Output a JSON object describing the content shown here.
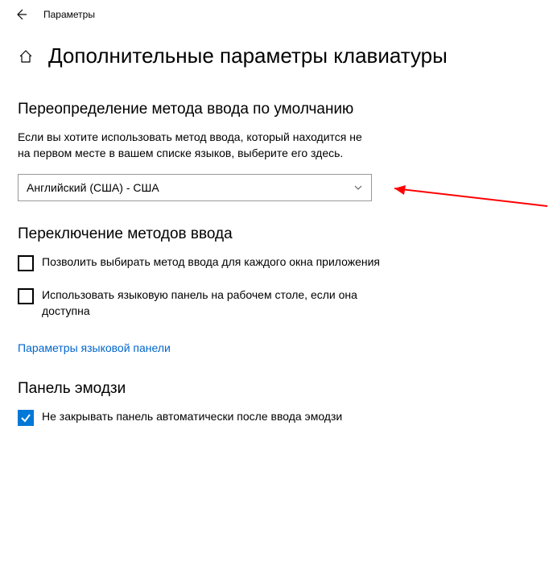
{
  "titlebar": {
    "title": "Параметры"
  },
  "header": {
    "title": "Дополнительные параметры клавиатуры"
  },
  "sections": {
    "override": {
      "title": "Переопределение метода ввода по умолчанию",
      "description": "Если вы хотите использовать метод ввода, который находится не на первом месте в вашем списке языков, выберите его здесь.",
      "select_value": "Английский (США) - США"
    },
    "switching": {
      "title": "Переключение методов ввода",
      "checkbox1_label": "Позволить выбирать метод ввода для каждого окна приложения",
      "checkbox2_label": "Использовать языковую панель на рабочем столе, если она доступна",
      "link_label": "Параметры языковой панели"
    },
    "emoji": {
      "title": "Панель эмодзи",
      "checkbox_label": "Не закрывать панель автоматически после ввода эмодзи"
    }
  }
}
